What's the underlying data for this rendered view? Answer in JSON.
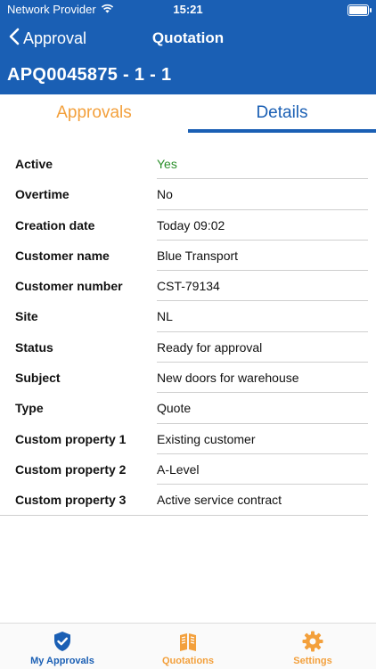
{
  "status_bar": {
    "carrier": "Network Provider",
    "time": "15:21"
  },
  "nav": {
    "back_label": "Approval",
    "title": "Quotation"
  },
  "record_id": "APQ0045875 - 1 - 1",
  "tabs": [
    {
      "label": "Approvals"
    },
    {
      "label": "Details",
      "selected": true
    }
  ],
  "details": [
    {
      "label": "Active",
      "value": "Yes"
    },
    {
      "label": "Overtime",
      "value": "No"
    },
    {
      "label": "Creation date",
      "value": "Today 09:02"
    },
    {
      "label": "Customer name",
      "value": "Blue Transport"
    },
    {
      "label": "Customer number",
      "value": "CST-79134"
    },
    {
      "label": "Site",
      "value": "NL"
    },
    {
      "label": "Status",
      "value": "Ready for approval"
    },
    {
      "label": "Subject",
      "value": "New doors for warehouse"
    },
    {
      "label": "Type",
      "value": "Quote"
    },
    {
      "label": "Custom property 1",
      "value": "Existing customer"
    },
    {
      "label": "Custom property 2",
      "value": "A-Level"
    },
    {
      "label": "Custom property 3",
      "value": "Active service contract"
    }
  ],
  "tab_bar": [
    {
      "label": "My Approvals",
      "icon": "shield-check-icon",
      "selected": true
    },
    {
      "label": "Quotations",
      "icon": "book-icon"
    },
    {
      "label": "Settings",
      "icon": "gear-icon"
    }
  ],
  "colors": {
    "primary_blue": "#1a5fb4",
    "accent_orange": "#f3a03c",
    "active_green": "#2a8f2a"
  }
}
